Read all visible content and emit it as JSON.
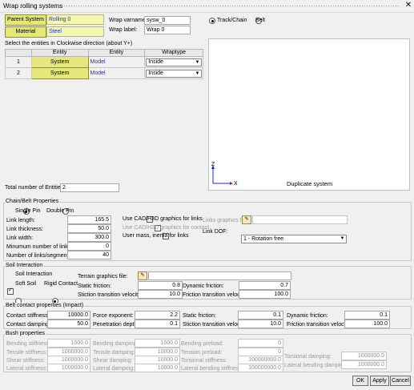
{
  "window": {
    "title": "Wrap rolling systems",
    "close_glyph": "✕"
  },
  "top": {
    "parent_system_button": "Parent System",
    "parent_system_value": "Rolling 0",
    "material_button": "Material",
    "material_value": "Steel",
    "varname_label": "Wrap varname:",
    "varname_value": "sysw_0",
    "wraplabel_label": "Wrap label:",
    "wraplabel_value": "Wrap 0",
    "track_chain_label": "Track/Chain",
    "belt_label": "Belt"
  },
  "entities": {
    "instruction": "Select the entities in Clockwise direction (about Y+)",
    "columns": [
      "Entity",
      "Entity",
      "Wraptype"
    ],
    "rows": [
      {
        "index": "1",
        "system": "System",
        "model": "Model",
        "wraptype": "Inside"
      },
      {
        "index": "2",
        "system": "System",
        "model": "Model",
        "wraptype": "Inside"
      }
    ],
    "total_label": "Total number of Entities:",
    "total_value": "2"
  },
  "viewport": {
    "axis_z": "Z",
    "axis_x": "X",
    "caption": "Duplicate system"
  },
  "chain": {
    "group_label": "Chain/Belt Properties",
    "single_pin": "Single Pin",
    "double_pin": "Double Pin",
    "link_length_label": "Link length:",
    "link_length_value": "165.5",
    "link_thickness_label": "Link thickness:",
    "link_thickness_value": "50.0",
    "link_width_label": "Link width:",
    "link_width_value": "300.0",
    "min_links_label": "Minumum number of links:",
    "min_links_value": "0",
    "links_segments_label": "Number of links/segments:",
    "links_segments_value": "40",
    "use_cad_links": "Use CAD/H3D graphics for links",
    "use_cad_contact": "Use CAD/H3D graphics for contact",
    "user_mass": "User mass, inertia for links",
    "links_graphics_label": "Links graphics file:",
    "link_dof_label": "Link DOF:",
    "link_dof_value": "1 - Rotation free"
  },
  "soil": {
    "group_label": "Soil Interaction",
    "soil_interaction": "Soil Interaction",
    "soft_soil": "Soft Soil",
    "rigid_contact": "Rigid Contact",
    "terrain_label": "Terrain graphics file:",
    "static_friction_label": "Static friction:",
    "static_friction_value": "0.8",
    "dynamic_friction_label": "Dynamic friction:",
    "dynamic_friction_value": "0.7",
    "stiction_label": "Stiction transition velocity:",
    "stiction_value": "10.0",
    "friction_tv_label": "Friction transition velocity:",
    "friction_tv_value": "100.0"
  },
  "belt": {
    "group_label": "Belt contact properties (Impact)",
    "contact_stiffness_label": "Contact stiffness:",
    "contact_stiffness_value": "10000.0",
    "force_exponent_label": "Force exponent:",
    "force_exponent_value": "2.2",
    "static_friction_label": "Static friction:",
    "static_friction_value": "0.1",
    "dynamic_friction_label": "Dynamic friction:",
    "dynamic_friction_value": "0.1",
    "contact_damping_label": "Contact damping:",
    "contact_damping_value": "50.0",
    "penetration_label": "Penetration depth:",
    "penetration_value": "0.1",
    "stiction_label": "Stiction transition velocity:",
    "stiction_value": "10.0",
    "friction_tv_label": "Friction transition velocity:",
    "friction_tv_value": "100.0"
  },
  "bush": {
    "group_label": "Bush properties",
    "bending_stiffness_label": "Bending stiffness:",
    "bending_stiffness_value": "1000.0",
    "bending_damping_label": "Bending damping:",
    "bending_damping_value": "1000.0",
    "bending_preload_label": "Bending preload:",
    "bending_preload_value": "0",
    "tensile_stiffness_label": "Tensile stiffness:",
    "tensile_stiffness_value": "1000000.0",
    "tensile_damping_label": "Tensile damping:",
    "tensile_damping_value": "10000.0",
    "tension_preload_label": "Tension preload:",
    "tension_preload_value": "0",
    "shear_stiffness_label": "Shear stiffness:",
    "shear_stiffness_value": "1000000.0",
    "shear_damping_label": "Shear damping:",
    "shear_damping_value": "10000.0",
    "torsional_stiffness_label": "Torsional stiffness:",
    "torsional_stiffness_value": "100000000.0",
    "torsional_damping_label": "Torsional damping:",
    "torsional_damping_value": "1000000.0",
    "lateral_stiffness_label": "Lateral stiffness:",
    "lateral_stiffness_value": "1000000.0",
    "lateral_damping_label": "Lateral damping:",
    "lateral_damping_value": "10000.0",
    "lateral_bending_stiffness_label": "Lateral bending stiffness:",
    "lateral_bending_stiffness_value": "100000000.0",
    "lateral_bending_damping_label": "Lateral bending damping:",
    "lateral_bending_damping_value": "1000000.0"
  },
  "buttons": {
    "ok": "OK",
    "apply": "Apply",
    "cancel": "Cancel"
  },
  "colors": {
    "system_button": "#e4e878",
    "model_link": "#2038a8",
    "axis": "#1c2bd6"
  }
}
